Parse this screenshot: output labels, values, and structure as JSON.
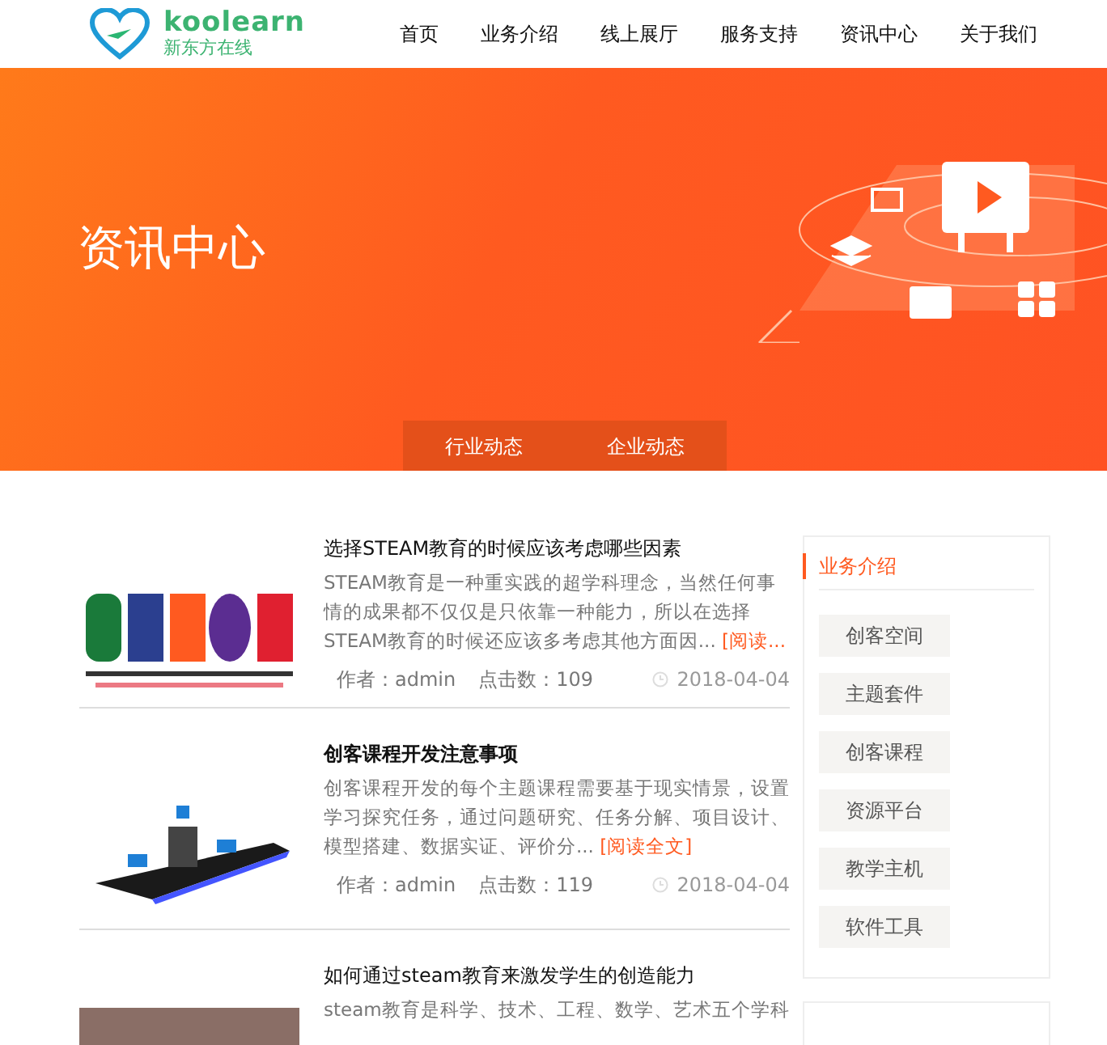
{
  "header": {
    "logo": {
      "brand": "koolearn",
      "subtitle": "新东方在线"
    },
    "nav": [
      {
        "label": "首页"
      },
      {
        "label": "业务介绍"
      },
      {
        "label": "线上展厅"
      },
      {
        "label": "服务支持"
      },
      {
        "label": "资讯中心"
      },
      {
        "label": "关于我们"
      }
    ]
  },
  "banner": {
    "title": "资讯中心",
    "tabs": [
      {
        "label": "行业动态"
      },
      {
        "label": "企业动态"
      }
    ]
  },
  "articles": [
    {
      "kind": "steam",
      "title": "选择STEAM教育的时候应该考虑哪些因素",
      "title_bold": false,
      "summary": "STEAM教育是一种重实践的超学科理念，当然任何事情的成果都不仅仅是只依靠一种能力，所以在选择STEAM教育的时候还应该多考虑其他方面因...",
      "read_more": "[阅读...",
      "author": "作者：admin",
      "clicks": "点击数：109",
      "date": "2018-04-04"
    },
    {
      "kind": "boat",
      "title": "创客课程开发注意事项",
      "title_bold": true,
      "summary": "创客课程开发的每个主题课程需要基于现实情景，设置学习探究任务，通过问题研究、任务分解、项目设计、模型搭建、数据实证、评价分...",
      "read_more": "[阅读全文]",
      "author": "作者：admin",
      "clicks": "点击数：119",
      "date": "2018-04-04"
    },
    {
      "kind": "photo",
      "title": "如何通过steam教育来激发学生的创造能力",
      "title_bold": false,
      "summary": "steam教育是科学、技术、工程、数学、艺术五个学科"
    }
  ],
  "sidebar": {
    "title": "业务介绍",
    "links": [
      {
        "label": "创客空间"
      },
      {
        "label": "主题套件"
      },
      {
        "label": "创客课程"
      },
      {
        "label": "资源平台"
      },
      {
        "label": "教学主机"
      },
      {
        "label": "软件工具"
      }
    ]
  }
}
